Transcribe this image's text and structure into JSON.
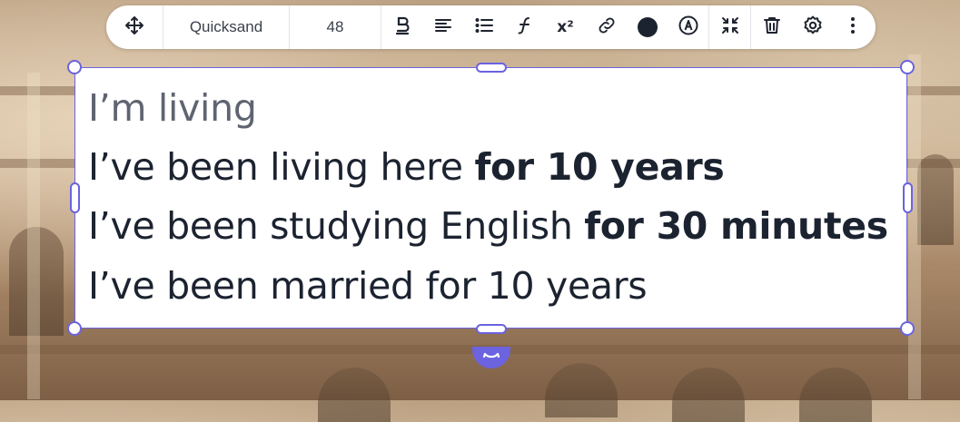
{
  "toolbar": {
    "font_name": "Quicksand",
    "font_size": "48",
    "text_color": "#1c2330",
    "icons": [
      "move-icon",
      "bold-icon",
      "align-left-icon",
      "list-icon",
      "font-function-icon",
      "superscript-icon",
      "link-icon",
      "color-icon",
      "animate-icon",
      "collapse-icon",
      "trash-icon",
      "settings-icon",
      "more-icon"
    ],
    "superscript_label": "x²"
  },
  "textbox": {
    "lines": [
      {
        "normal": "I’m living",
        "bold": ""
      },
      {
        "normal": "I’ve been living here ",
        "bold": "for 10 years"
      },
      {
        "normal": "I’ve been studying English ",
        "bold": "for 30 minutes"
      },
      {
        "normal": "I’ve been married for 10 years",
        "bold": ""
      }
    ]
  },
  "colors": {
    "accent": "#6b63e0",
    "text": "#1c2330"
  }
}
